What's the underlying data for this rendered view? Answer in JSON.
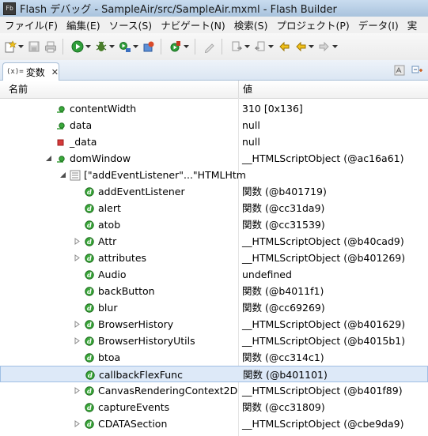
{
  "window": {
    "title": "Flash デバッグ - SampleAir/src/SampleAir.mxml - Flash Builder",
    "app_icon_text": "Fb"
  },
  "menu": [
    "ファイル(F)",
    "編集(E)",
    "ソース(S)",
    "ナビゲート(N)",
    "検索(S)",
    "プロジェクト(P)",
    "データ(I)",
    "実"
  ],
  "view": {
    "tab_icon": "(x)=",
    "tab_label": "変数",
    "close_glyph": "✕"
  },
  "table": {
    "columns": {
      "name": "名前",
      "value": "値"
    },
    "rows": [
      {
        "name": "contentWidth",
        "value": "310 [0x136]",
        "icon": "public-field-icon",
        "indent": 0,
        "twisty": "none"
      },
      {
        "name": "data",
        "value": "null",
        "icon": "public-field-icon",
        "indent": 0,
        "twisty": "none"
      },
      {
        "name": "_data",
        "value": "null",
        "icon": "private-field-icon",
        "indent": 0,
        "twisty": "none"
      },
      {
        "name": "domWindow",
        "value": "__HTMLScriptObject (@ac16a61)",
        "icon": "public-field-icon",
        "indent": 0,
        "twisty": "expanded"
      },
      {
        "name": "[\"addEventListener\"...\"HTMLHtm",
        "value": "",
        "icon": "array-group-icon",
        "indent": 1,
        "twisty": "expanded"
      },
      {
        "name": "addEventListener",
        "value": "関数 (@b401719)",
        "icon": "dynamic-property-icon",
        "indent": 2,
        "twisty": "none"
      },
      {
        "name": "alert",
        "value": "関数 (@cc31da9)",
        "icon": "dynamic-property-icon",
        "indent": 2,
        "twisty": "none"
      },
      {
        "name": "atob",
        "value": "関数 (@cc31539)",
        "icon": "dynamic-property-icon",
        "indent": 2,
        "twisty": "none"
      },
      {
        "name": "Attr",
        "value": "__HTMLScriptObject (@b40cad9)",
        "icon": "dynamic-property-icon",
        "indent": 2,
        "twisty": "collapsed"
      },
      {
        "name": "attributes",
        "value": "__HTMLScriptObject (@b401269)",
        "icon": "dynamic-property-icon",
        "indent": 2,
        "twisty": "collapsed"
      },
      {
        "name": "Audio",
        "value": "undefined",
        "icon": "dynamic-property-icon",
        "indent": 2,
        "twisty": "none"
      },
      {
        "name": "backButton",
        "value": "関数 (@b4011f1)",
        "icon": "dynamic-property-icon",
        "indent": 2,
        "twisty": "none"
      },
      {
        "name": "blur",
        "value": "関数 (@cc69269)",
        "icon": "dynamic-property-icon",
        "indent": 2,
        "twisty": "none"
      },
      {
        "name": "BrowserHistory",
        "value": "__HTMLScriptObject (@b401629)",
        "icon": "dynamic-property-icon",
        "indent": 2,
        "twisty": "collapsed"
      },
      {
        "name": "BrowserHistoryUtils",
        "value": "__HTMLScriptObject (@b4015b1)",
        "icon": "dynamic-property-icon",
        "indent": 2,
        "twisty": "collapsed"
      },
      {
        "name": "btoa",
        "value": "関数 (@cc314c1)",
        "icon": "dynamic-property-icon",
        "indent": 2,
        "twisty": "none"
      },
      {
        "name": "callbackFlexFunc",
        "value": "関数 (@b401101)",
        "icon": "dynamic-property-icon",
        "indent": 2,
        "twisty": "none",
        "selected": true
      },
      {
        "name": "CanvasRenderingContext2D",
        "value": "__HTMLScriptObject (@b401f89)",
        "icon": "dynamic-property-icon",
        "indent": 2,
        "twisty": "collapsed"
      },
      {
        "name": "captureEvents",
        "value": "関数 (@cc31809)",
        "icon": "dynamic-property-icon",
        "indent": 2,
        "twisty": "none"
      },
      {
        "name": "CDATASection",
        "value": "__HTMLScriptObject (@cbe9da9)",
        "icon": "dynamic-property-icon",
        "indent": 2,
        "twisty": "collapsed"
      }
    ]
  },
  "colors": {
    "selection": "#dde9f8",
    "field_green": "#2e9a2e",
    "private_red": "#d63a3a"
  }
}
